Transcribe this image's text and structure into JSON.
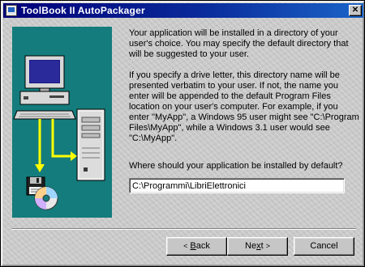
{
  "window": {
    "title": "ToolBook II AutoPackager",
    "close_glyph": "✕"
  },
  "main": {
    "paragraph1": "Your application will be installed in a directory of your user's choice. You may specify the default directory that will be suggested to your user.",
    "paragraph2": "If you specify a drive letter, this directory name will be presented verbatim to your user. If not, the name you enter will be appended to the default Program Files location on your user's computer. For example, if you enter \"MyApp\", a Windows 95 user might see \"C:\\Program Files\\MyApp\", while a Windows 3.1 user would see \"C:\\MyApp\".",
    "question": "Where should your application be installed by default?",
    "install_path": "C:\\Programmi\\LibriElettronici"
  },
  "buttons": {
    "back_arrow": "<",
    "back_key": "B",
    "back_rest": "ack",
    "next_pre": "Ne",
    "next_key": "x",
    "next_rest": "t",
    "next_arrow": ">",
    "cancel": "Cancel"
  },
  "colors": {
    "title_bar_start": "#000078",
    "title_bar_end": "#1a64c8",
    "illustration_bg": "#147c7c",
    "arrow_yellow": "#ffff00"
  },
  "icons": [
    "app-icon",
    "close-icon",
    "desktop-computer-icon",
    "tower-computer-icon",
    "floppy-disk-icon",
    "cd-rom-icon"
  ]
}
